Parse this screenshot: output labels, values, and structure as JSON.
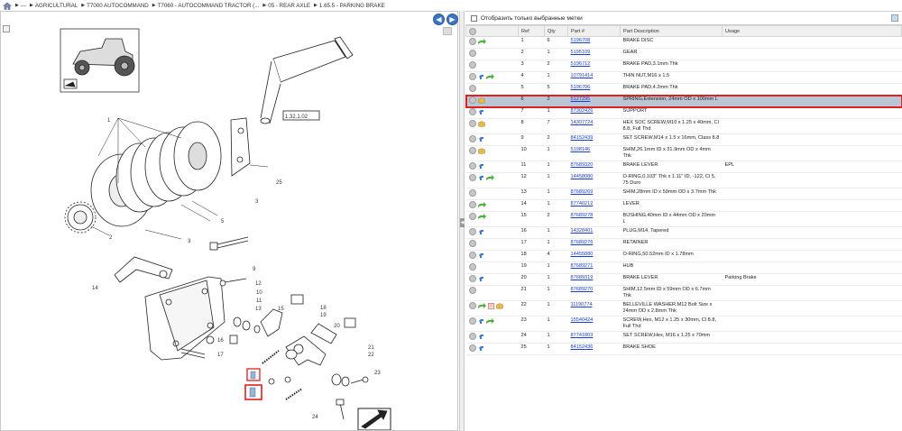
{
  "breadcrumb": {
    "home_icon": "home-icon",
    "items": [
      "---",
      "AGRICULTURAL",
      "T7000 AUTOCOMMAND",
      "T7060 - AUTOCOMMAND TRACTOR (...",
      "05 - REAR AXLE",
      "1.65.5 - PARKING BRAKE"
    ]
  },
  "diagram": {
    "callouts": [
      "1",
      "2",
      "3",
      "4",
      "5",
      "6",
      "9",
      "12",
      "10",
      "11",
      "13",
      "14",
      "15",
      "16",
      "17",
      "18",
      "19",
      "20",
      "21",
      "22",
      "23",
      "24",
      "25"
    ],
    "ref_box_label": "1.32.1.02",
    "left_nav": "back-arrow-icon",
    "right_nav": "forward-arrow-icon"
  },
  "filter": {
    "label": "Отобразить только выбранные метки"
  },
  "table": {
    "columns": [
      "",
      "Ref",
      "Qty",
      "Part #",
      "Part Description",
      "Usage"
    ],
    "rows": [
      {
        "ref": "1",
        "qty": "6",
        "part": "5196708",
        "desc": "BRAKE DISC",
        "usage": "",
        "icons": [
          "go"
        ]
      },
      {
        "ref": "2",
        "qty": "1",
        "part": "5195109",
        "desc": "GEAR",
        "usage": "",
        "icons": []
      },
      {
        "ref": "3",
        "qty": "2",
        "part": "5196712",
        "desc": "BRAKE PAD,3.1mm Thk",
        "usage": "",
        "icons": []
      },
      {
        "ref": "4",
        "qty": "1",
        "part": "10791414",
        "desc": "THIN NUT,M16 x 1.5",
        "usage": "",
        "icons": [
          "info",
          "go"
        ]
      },
      {
        "ref": "5",
        "qty": "5",
        "part": "5196706",
        "desc": "BRAKE PAD,4.2mm Thk",
        "usage": "",
        "icons": []
      },
      {
        "ref": "6",
        "qty": "2",
        "part": "5127295",
        "desc": "SPRING,Extension, 24mm OD x 100mm L",
        "usage": "",
        "icons": [
          "pkg"
        ],
        "selected": true
      },
      {
        "ref": "7",
        "qty": "1",
        "part": "87302426",
        "desc": "SUPPORT",
        "usage": "",
        "icons": [
          "info"
        ]
      },
      {
        "ref": "8",
        "qty": "7",
        "part": "14307724",
        "desc": "HEX SOC SCREW,M10 x 1.25 x 40mm, Cl 8.8, Full Thd",
        "usage": "",
        "icons": [
          "pkg"
        ]
      },
      {
        "ref": "9",
        "qty": "2",
        "part": "84152439",
        "desc": "SET SCREW,M14 x 1.5 x 16mm, Class 8.8",
        "usage": "",
        "icons": [
          "info"
        ]
      },
      {
        "ref": "10",
        "qty": "1",
        "part": "5198146",
        "desc": "SHIM,26.1mm ID x 31.9mm OD x 4mm Thk",
        "usage": "",
        "icons": [
          "pkg"
        ]
      },
      {
        "ref": "11",
        "qty": "1",
        "part": "87689320",
        "desc": "BRAKE LEVER",
        "usage": "EPL",
        "icons": [
          "info"
        ]
      },
      {
        "ref": "12",
        "qty": "1",
        "part": "14458080",
        "desc": "O-RING,0.103\" Thk x 1.11\" ID, -122, Cl 5, 75 Duro",
        "usage": "",
        "icons": [
          "info",
          "go"
        ]
      },
      {
        "ref": "13",
        "qty": "1",
        "part": "87689269",
        "desc": "SHIM,28mm ID x 59mm OD x 3.7mm Thk",
        "usage": "",
        "icons": []
      },
      {
        "ref": "14",
        "qty": "1",
        "part": "87740212",
        "desc": "LEVER",
        "usage": "",
        "icons": [
          "go"
        ]
      },
      {
        "ref": "15",
        "qty": "2",
        "part": "87689278",
        "desc": "BUSHING,40mm ID x 44mm OD x 20mm L",
        "usage": "",
        "icons": [
          "go"
        ]
      },
      {
        "ref": "16",
        "qty": "1",
        "part": "14328401",
        "desc": "PLUG,M14, Tapered",
        "usage": "",
        "icons": [
          "info"
        ]
      },
      {
        "ref": "17",
        "qty": "1",
        "part": "87689276",
        "desc": "RETAINER",
        "usage": "",
        "icons": []
      },
      {
        "ref": "18",
        "qty": "4",
        "part": "14455880",
        "desc": "O-RING,50.52mm ID x 1.78mm",
        "usage": "",
        "icons": [
          "info"
        ]
      },
      {
        "ref": "19",
        "qty": "1",
        "part": "87689271",
        "desc": "HUB",
        "usage": "",
        "icons": []
      },
      {
        "ref": "20",
        "qty": "1",
        "part": "87689319",
        "desc": "BRAKE LEVER",
        "usage": "Parking Brake",
        "icons": [
          "info"
        ]
      },
      {
        "ref": "21",
        "qty": "1",
        "part": "87689270",
        "desc": "SHIM,12.5mm ID x 59mm OD x 6.7mm Thk",
        "usage": "",
        "icons": []
      },
      {
        "ref": "22",
        "qty": "1",
        "part": "11190774",
        "desc": "BELLEVILLE WASHER,M12 Bolt Size x 24mm OD x 2.8mm Thk",
        "usage": "",
        "icons": [
          "go",
          "note",
          "pkg"
        ]
      },
      {
        "ref": "23",
        "qty": "1",
        "part": "15540424",
        "desc": "SCREW,Hex, M12 x 1.25 x 30mm, Cl 8.8, Full Thd",
        "usage": "",
        "icons": [
          "info",
          "go"
        ]
      },
      {
        "ref": "24",
        "qty": "1",
        "part": "87741803",
        "desc": "SET SCREW,Hex, M16 x 1.25 x 70mm",
        "usage": "",
        "icons": [
          "info"
        ]
      },
      {
        "ref": "25",
        "qty": "1",
        "part": "84152436",
        "desc": "BRAKE SHOE",
        "usage": "",
        "icons": [
          "info"
        ]
      }
    ]
  },
  "colors": {
    "selected_row_bg": "#b8c6d6",
    "highlight_border": "#e02020",
    "link": "#1a3fd0",
    "nav_button": "#3a76c4"
  }
}
